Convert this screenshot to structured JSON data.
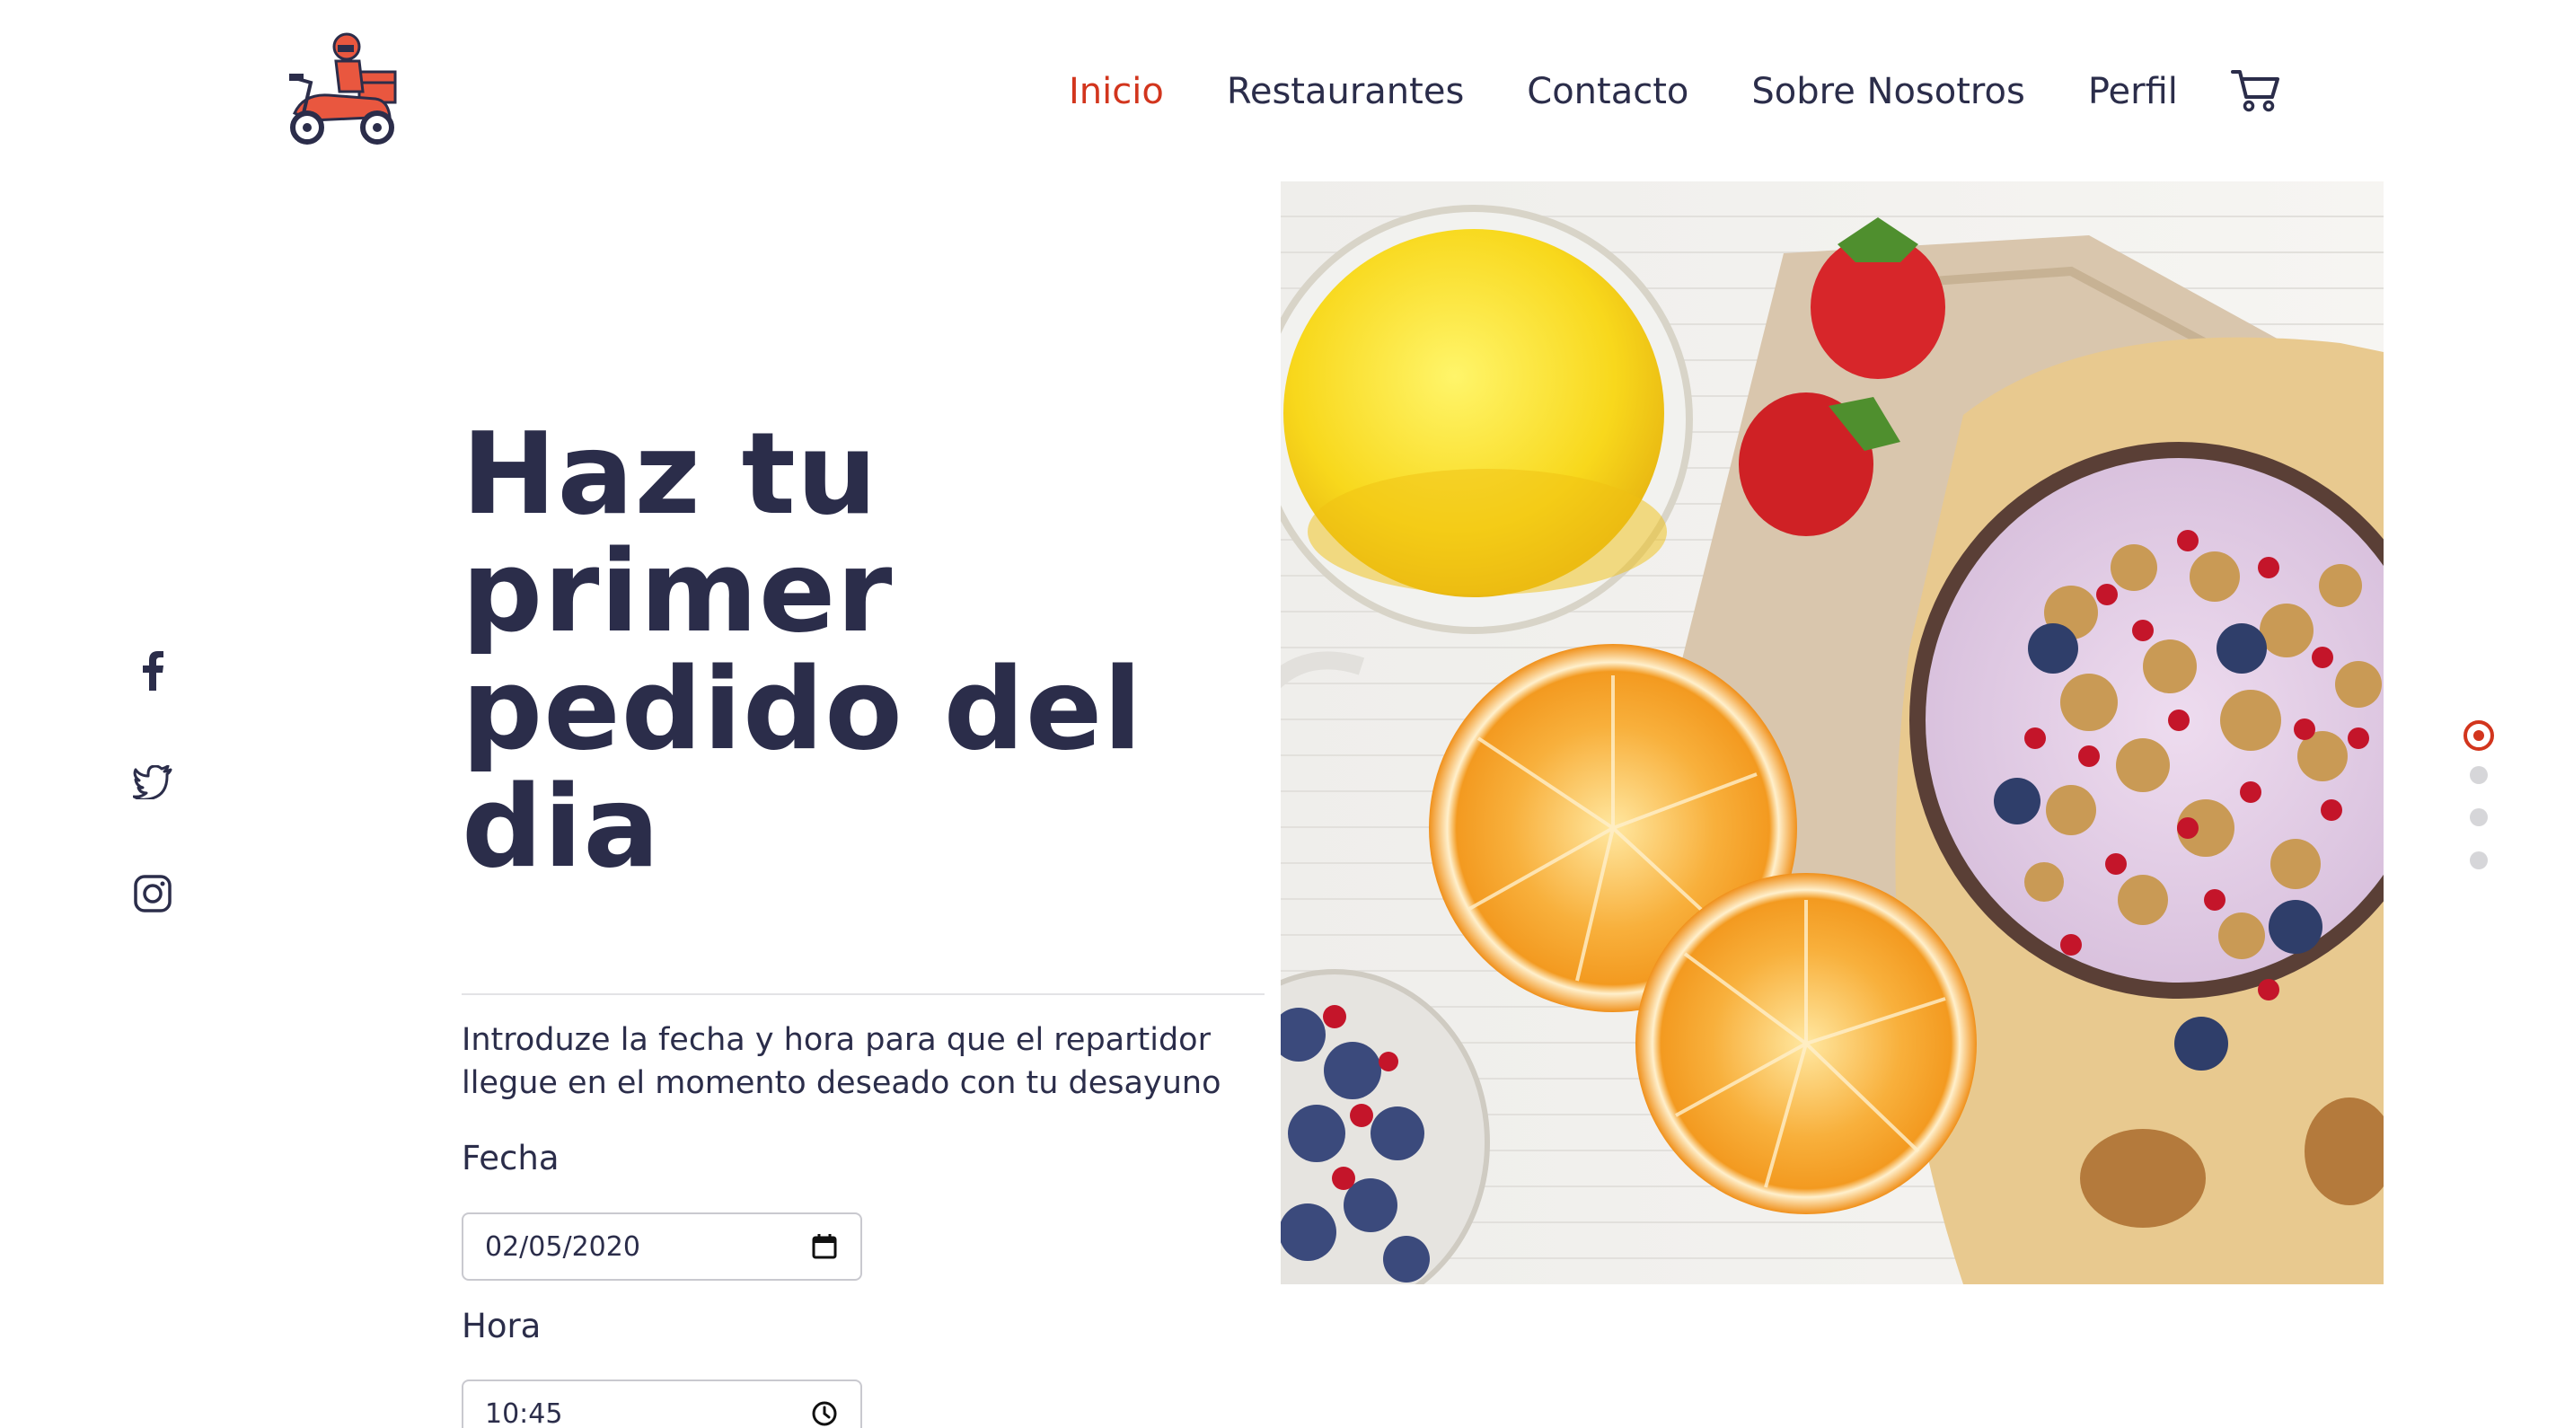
{
  "brand": {
    "logo_icon": "delivery-scooter-icon"
  },
  "nav": {
    "items": [
      {
        "label": "Inicio",
        "active": true
      },
      {
        "label": "Restaurantes",
        "active": false
      },
      {
        "label": "Contacto",
        "active": false
      },
      {
        "label": "Sobre Nosotros",
        "active": false
      },
      {
        "label": "Perfil",
        "active": false
      }
    ],
    "cart_icon": "shopping-cart-icon",
    "active_color": "#d2351d",
    "text_color": "#2b2d4a"
  },
  "social": [
    "facebook-icon",
    "twitter-icon",
    "instagram-icon"
  ],
  "hero": {
    "title_lines": [
      "Haz tu",
      "primer",
      "pedido del",
      "dia"
    ],
    "intro_lines": [
      "Introduze la fecha y hora para que el repartidor",
      "llegue en el momento deseado con tu desayuno"
    ]
  },
  "form": {
    "date_label": "Fecha",
    "date_value": "02/05/2020",
    "date_icon": "calendar-icon",
    "time_label": "Hora",
    "time_value": "10:45",
    "time_icon": "clock-icon"
  },
  "carousel": {
    "slides": 4,
    "active_index": 0
  }
}
